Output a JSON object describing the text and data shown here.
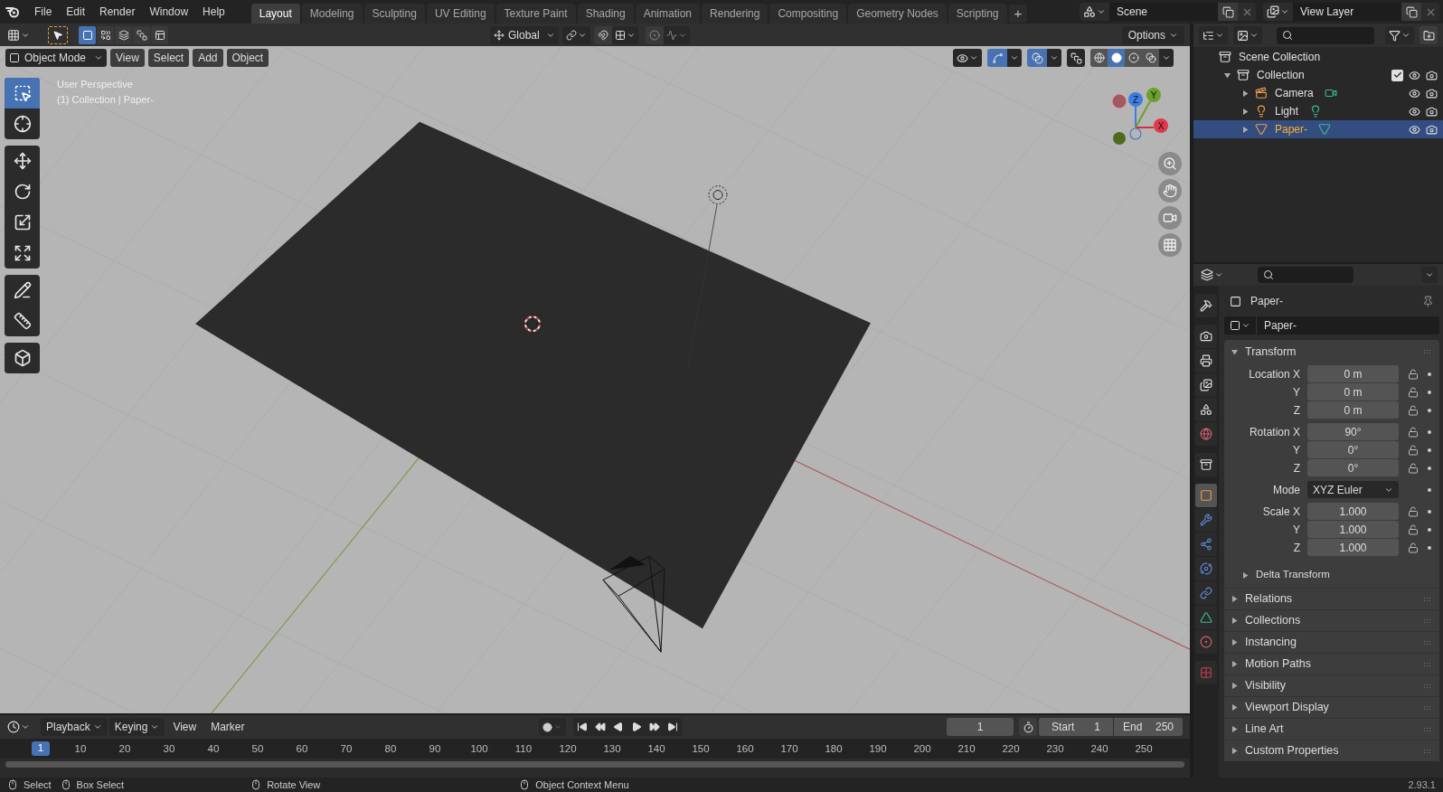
{
  "top_menu": [
    "File",
    "Edit",
    "Render",
    "Window",
    "Help"
  ],
  "workspaces": [
    {
      "label": "Layout",
      "selected": true
    },
    {
      "label": "Modeling",
      "selected": false
    },
    {
      "label": "Sculpting",
      "selected": false
    },
    {
      "label": "UV Editing",
      "selected": false
    },
    {
      "label": "Texture Paint",
      "selected": false
    },
    {
      "label": "Shading",
      "selected": false
    },
    {
      "label": "Animation",
      "selected": false
    },
    {
      "label": "Rendering",
      "selected": false
    },
    {
      "label": "Compositing",
      "selected": false
    },
    {
      "label": "Geometry Nodes",
      "selected": false
    },
    {
      "label": "Scripting",
      "selected": false
    }
  ],
  "add_workspace": "+",
  "scene": "Scene",
  "view_layer": "View Layer",
  "tool_header": {
    "select_modes": [
      {
        "selected": true
      },
      {
        "selected": false
      },
      {
        "selected": false
      },
      {
        "selected": false
      },
      {
        "selected": false
      }
    ],
    "orientation": "Global",
    "options": "Options"
  },
  "viewport": {
    "mode": "Object Mode",
    "menus": [
      "View",
      "Select",
      "Add",
      "Object"
    ],
    "info": [
      "User Perspective",
      "(1) Collection | Paper-"
    ],
    "tools": [
      {
        "selected": true
      },
      {
        "selected": false
      },
      {
        "selected": false
      },
      {
        "selected": false
      },
      {
        "selected": false
      },
      {
        "selected": false
      },
      {
        "selected": false
      },
      {
        "selected": false
      },
      {
        "selected": false
      }
    ],
    "shading": [
      {
        "selected": false
      },
      {
        "selected": true
      },
      {
        "selected": false
      },
      {
        "selected": false
      }
    ],
    "gizmo_axes": [
      "X",
      "Y",
      "Z"
    ]
  },
  "outliner": {
    "tree": [
      {
        "name": "Scene Collection",
        "kind": "scene_collection",
        "selected": false,
        "children": [
          {
            "name": "Collection",
            "kind": "collection",
            "expanded": true,
            "checked": true,
            "selected": false,
            "children": [
              {
                "name": "Camera",
                "kind": "camera",
                "expanded": false,
                "selected": false
              },
              {
                "name": "Light",
                "kind": "light",
                "expanded": false,
                "selected": false
              },
              {
                "name": "Paper-",
                "kind": "mesh",
                "expanded": false,
                "selected": true
              }
            ]
          }
        ]
      }
    ]
  },
  "properties": {
    "tabs": [
      {
        "selected": false
      },
      {
        "selected": false
      },
      {
        "selected": false
      },
      {
        "selected": false
      },
      {
        "selected": false
      },
      {
        "selected": false
      },
      {
        "selected": false
      },
      {
        "selected": true
      },
      {
        "selected": false
      },
      {
        "selected": false
      },
      {
        "selected": false
      },
      {
        "selected": false
      },
      {
        "selected": false
      },
      {
        "selected": false
      },
      {
        "selected": false
      }
    ],
    "object": "Paper-",
    "datablock": "Paper-",
    "transform": {
      "title": "Transform",
      "expanded": true,
      "groups": [
        [
          {
            "kind": "number",
            "label": "Location X",
            "value": "0 m"
          },
          {
            "kind": "number",
            "label": "Y",
            "value": "0 m"
          },
          {
            "kind": "number",
            "label": "Z",
            "value": "0 m"
          }
        ],
        [
          {
            "kind": "number",
            "label": "Rotation X",
            "value": "90°"
          },
          {
            "kind": "number",
            "label": "Y",
            "value": "0°"
          },
          {
            "kind": "number",
            "label": "Z",
            "value": "0°"
          }
        ],
        [
          {
            "kind": "dropdown",
            "label": "Mode",
            "value": "XYZ Euler"
          }
        ],
        [
          {
            "kind": "number",
            "label": "Scale X",
            "value": "1.000"
          },
          {
            "kind": "number",
            "label": "Y",
            "value": "1.000"
          },
          {
            "kind": "number",
            "label": "Z",
            "value": "1.000"
          }
        ]
      ],
      "subpanels": [
        {
          "title": "Delta Transform",
          "expanded": false
        }
      ]
    },
    "panels": [
      {
        "title": "Relations",
        "expanded": false
      },
      {
        "title": "Collections",
        "expanded": false
      },
      {
        "title": "Instancing",
        "expanded": false
      },
      {
        "title": "Motion Paths",
        "expanded": false
      },
      {
        "title": "Visibility",
        "expanded": false
      },
      {
        "title": "Viewport Display",
        "expanded": false
      },
      {
        "title": "Line Art",
        "expanded": false
      },
      {
        "title": "Custom Properties",
        "expanded": false
      }
    ]
  },
  "timeline": {
    "menus": [
      {
        "label": "Playback",
        "kind": "dropdown"
      },
      {
        "label": "Keying",
        "kind": "dropdown"
      },
      {
        "label": "View",
        "kind": "menu"
      },
      {
        "label": "Marker",
        "kind": "menu"
      }
    ],
    "auto_keying": false,
    "current_frame": "1",
    "start_label": "Start",
    "start": "1",
    "end_label": "End",
    "end": "250",
    "playhead": "1",
    "ticks": [
      "10",
      "20",
      "30",
      "40",
      "50",
      "60",
      "70",
      "80",
      "90",
      "100",
      "110",
      "120",
      "130",
      "140",
      "150",
      "160",
      "170",
      "180",
      "190",
      "200",
      "210",
      "220",
      "230",
      "240",
      "250"
    ]
  },
  "status_bar": {
    "hints": [
      "Select",
      "Box Select",
      "Rotate View",
      "Object Context Menu"
    ],
    "version": "2.93.1"
  }
}
